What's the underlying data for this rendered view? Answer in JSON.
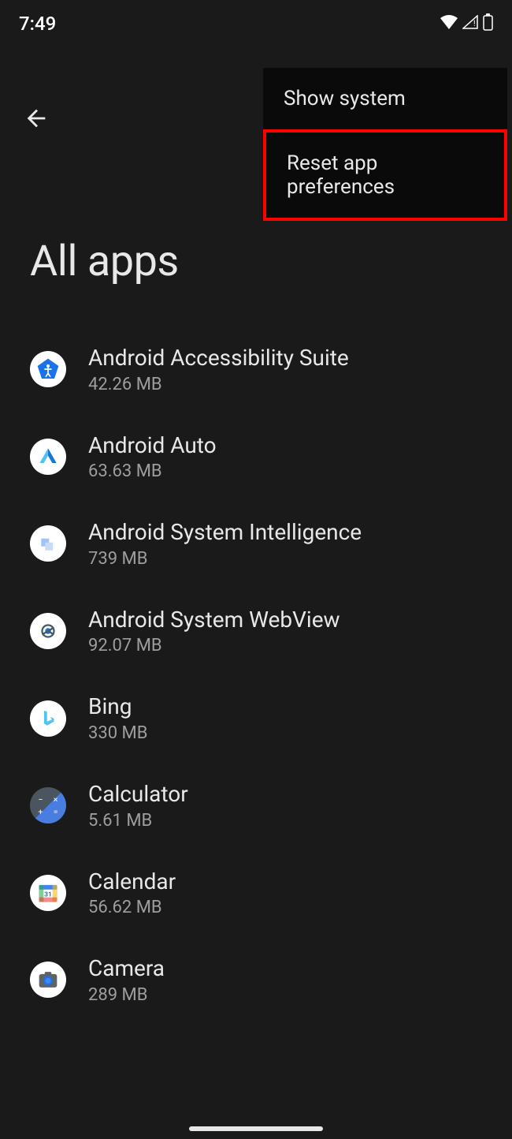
{
  "status": {
    "time": "7:49"
  },
  "page": {
    "title": "All apps"
  },
  "menu": {
    "items": [
      {
        "label": "Show system",
        "highlighted": false
      },
      {
        "label": "Reset app preferences",
        "highlighted": true
      }
    ]
  },
  "apps": [
    {
      "name": "Android Accessibility Suite",
      "size": "42.26 MB",
      "icon": "accessibility-icon"
    },
    {
      "name": "Android Auto",
      "size": "63.63 MB",
      "icon": "android-auto-icon"
    },
    {
      "name": "Android System Intelligence",
      "size": "739 MB",
      "icon": "system-intelligence-icon"
    },
    {
      "name": "Android System WebView",
      "size": "92.07 MB",
      "icon": "webview-icon"
    },
    {
      "name": "Bing",
      "size": "330 MB",
      "icon": "bing-icon"
    },
    {
      "name": "Calculator",
      "size": "5.61 MB",
      "icon": "calculator-icon"
    },
    {
      "name": "Calendar",
      "size": "56.62 MB",
      "icon": "calendar-icon"
    },
    {
      "name": "Camera",
      "size": "289 MB",
      "icon": "camera-icon"
    }
  ]
}
